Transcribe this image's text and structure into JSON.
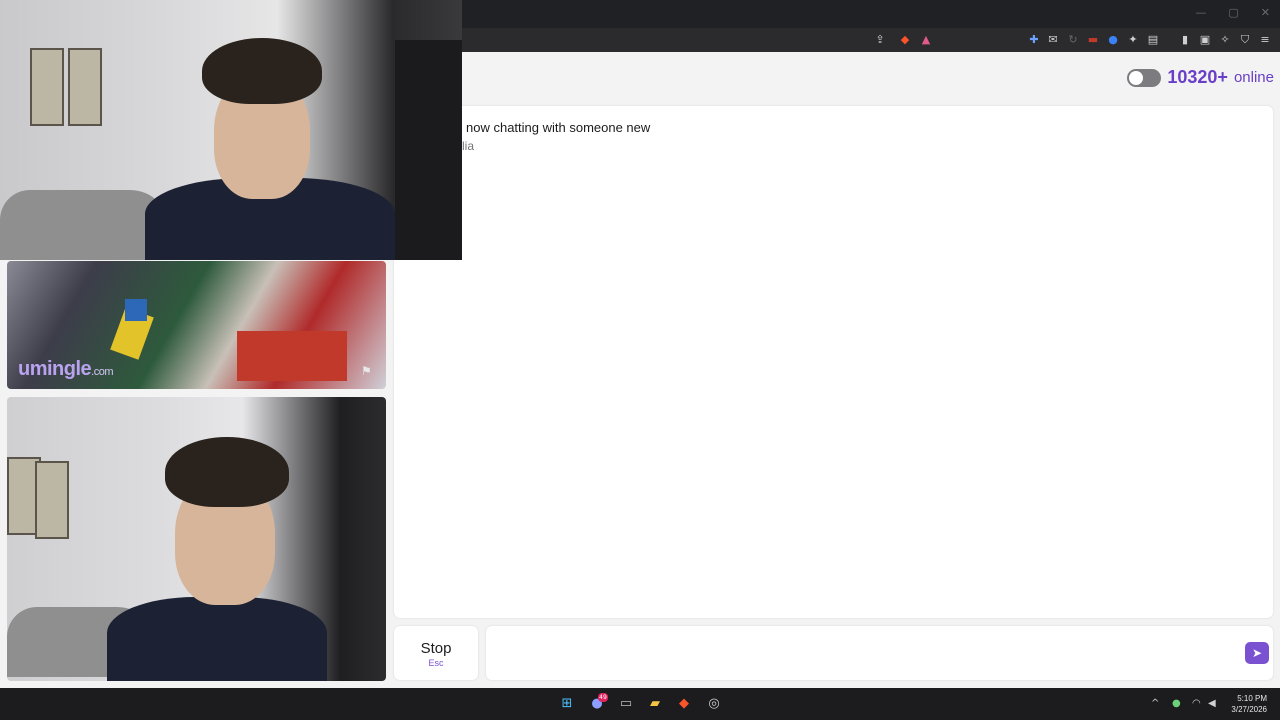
{
  "window": {
    "minimize": "—",
    "restore": "▢",
    "close": "✕"
  },
  "browser": {
    "icons": [
      "share-icon",
      "brave-shields-icon",
      "brave-rewards-icon",
      "extension-icons",
      "sidebar-icon",
      "menu-icon"
    ]
  },
  "header": {
    "online_count": "10320+",
    "online_label": "online"
  },
  "chat": {
    "status_line": "now chatting with someone new",
    "sub_line": "lia"
  },
  "video": {
    "logo_text": "umingle",
    "logo_domain": ".com"
  },
  "controls": {
    "stop_label": "Stop",
    "stop_key": "Esc",
    "message_placeholder": "",
    "send_icon": "send-icon"
  },
  "taskbar": {
    "discord_badge": "49",
    "time": "5:10 PM",
    "date": "3/27/2026"
  },
  "colors": {
    "accent": "#6a3fc8",
    "button": "#7a52d1"
  }
}
